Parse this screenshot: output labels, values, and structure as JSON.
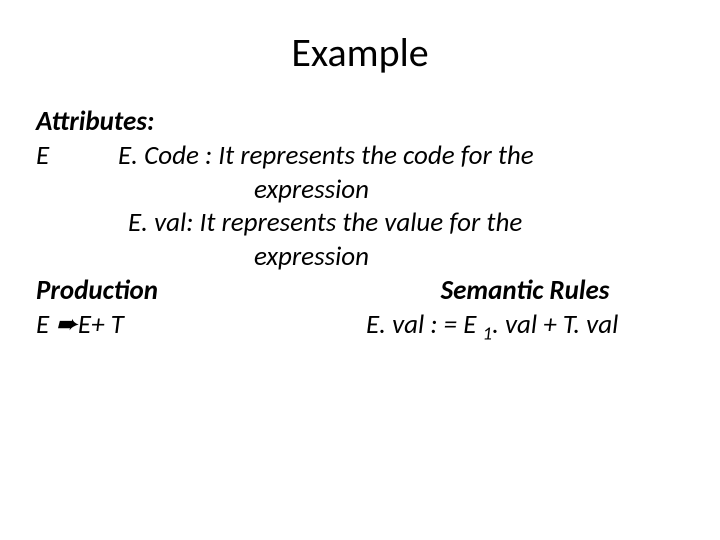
{
  "title": "Example",
  "attrHeading": "Attributes:",
  "symbol": "E",
  "attr1a": "E. Code : It represents the code for the",
  "attr1b": "expression",
  "attr2a": "E. val: It represents the value for the",
  "attr2b": "expression",
  "prodHeading": "Production",
  "semHeading": "Semantic Rules",
  "prodLHS_E1": "E ",
  "prodLHS_arrow": "➨",
  "prodLHS_rest": "E+ T",
  "rule_p1": "E. val : = E ",
  "rule_sub": "1",
  "rule_p2": ". val + T. val"
}
